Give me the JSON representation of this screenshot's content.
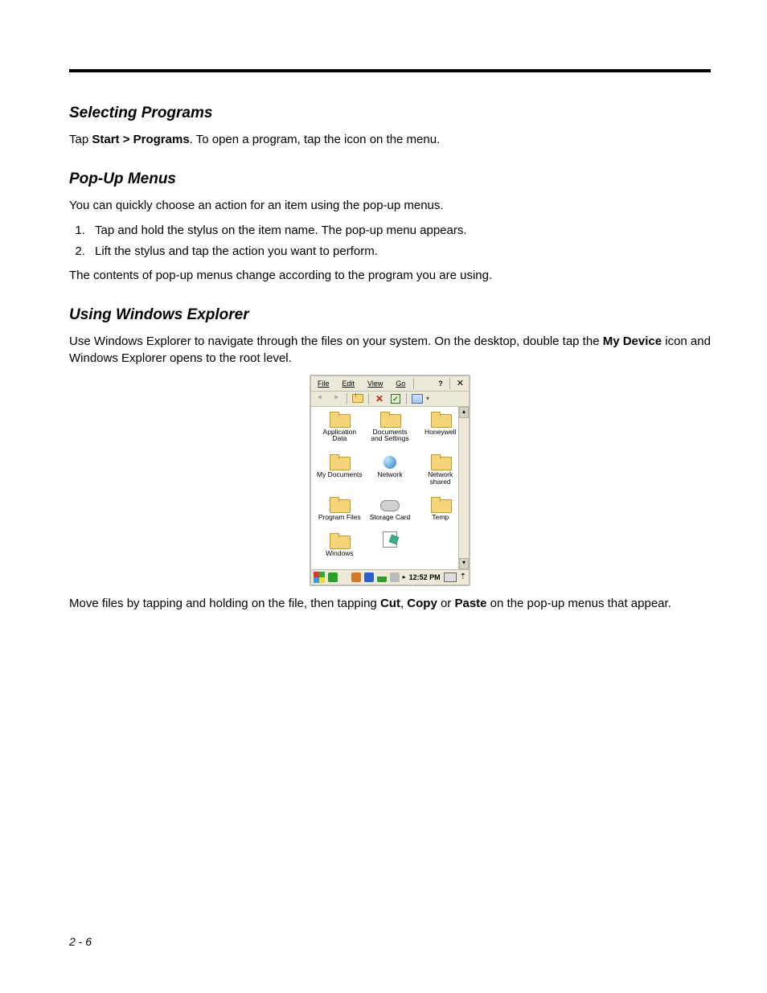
{
  "sections": {
    "s1": {
      "title": "Selecting Programs"
    },
    "s2": {
      "title": "Pop-Up Menus"
    },
    "s3": {
      "title": "Using Windows Explorer"
    }
  },
  "text": {
    "p1_a": "Tap ",
    "p1_b": "Start > Programs",
    "p1_c": ". To open a program, tap the icon on the menu.",
    "p2": "You can quickly choose an action for an item using the pop-up menus.",
    "li1": "Tap and hold the stylus on the item name. The pop-up menu appears.",
    "li2": "Lift the stylus and tap the action you want to perform.",
    "p3": "The contents of pop-up menus change according to the program you are using.",
    "p4_a": "Use Windows Explorer to navigate through the files on your system. On the desktop, double tap the ",
    "p4_b": "My Device",
    "p4_c": " icon and Windows Explorer opens to the root level.",
    "p5_a": "Move files by tapping and holding on the file, then tapping ",
    "p5_b": "Cut",
    "p5_c": ", ",
    "p5_d": "Copy",
    "p5_e": " or ",
    "p5_f": "Paste",
    "p5_g": " on the pop-up menus that appear."
  },
  "explorer": {
    "menu": {
      "file": "File",
      "edit": "Edit",
      "view": "View",
      "go": "Go"
    },
    "folders": [
      "Application Data",
      "Documents and Settings",
      "Honeywell",
      "My Documents",
      "Network",
      "Network shared",
      "Program Files",
      "Storage Card",
      "Temp",
      "Windows"
    ],
    "time": "12:52 PM"
  },
  "page_number": "2 - 6"
}
